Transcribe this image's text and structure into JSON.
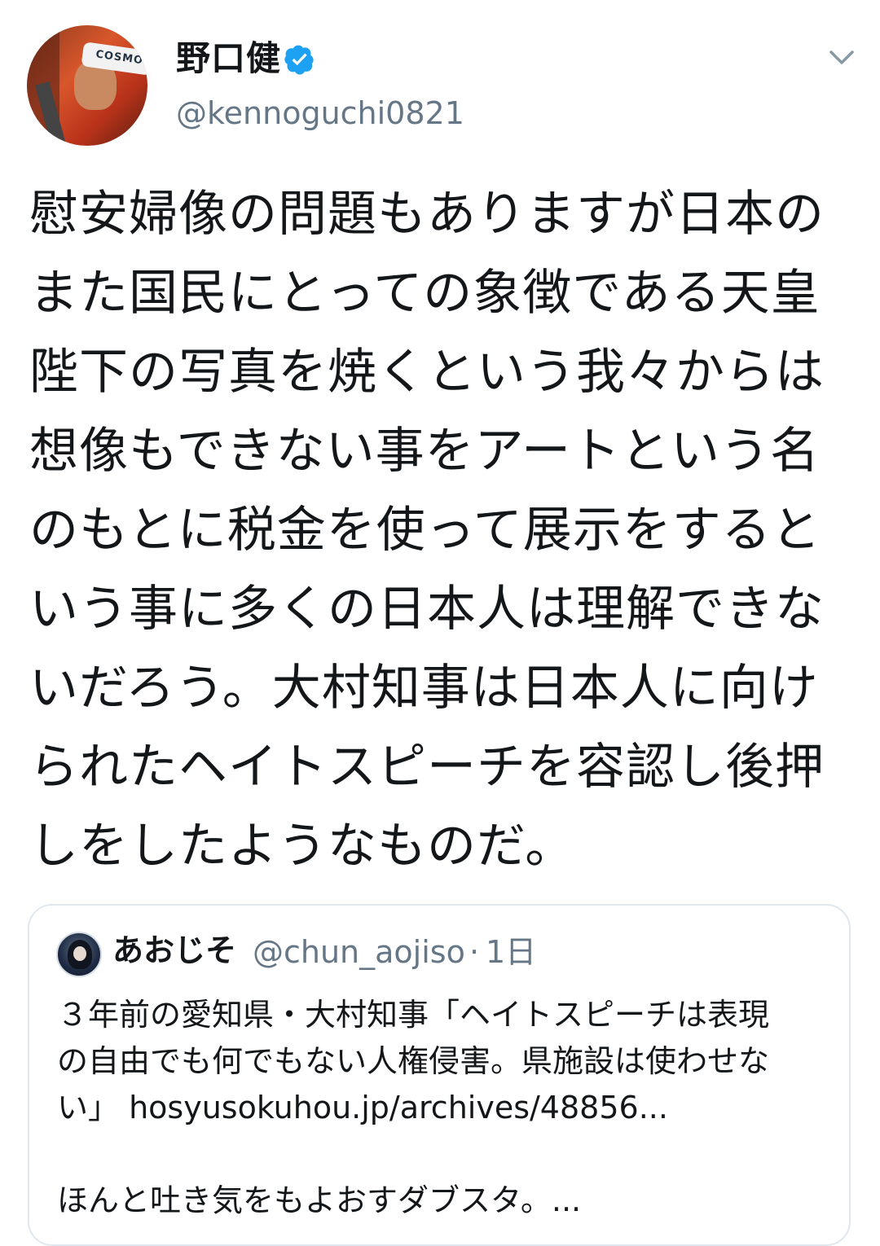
{
  "author": {
    "name": "野口健",
    "handle": "@kennoguchi0821",
    "avatar_badge_text": "COSMO",
    "verified": true,
    "verified_color": "#1da1f2"
  },
  "tweet": {
    "lines": [
      "慰安婦像の問題もありますが日本の",
      "また国民にとっての象徴である天皇",
      "陛下の写真を焼くという我々からは",
      "想像もできない事をアートという名",
      "のもとに税金を使って展示をすると",
      "いう事に多くの日本人は理解できな",
      "いだろう。大村知事は日本人に向け",
      "られたヘイトスピーチを容認し後押",
      "しをしたようなものだ。"
    ]
  },
  "quoted_tweet": {
    "name": "あおじそ",
    "handle": "@chun_aojiso",
    "separator": "·",
    "time": "1日",
    "lines": [
      "３年前の愛知県・大村知事「ヘイトスピーチは表現",
      "の自由でも何でもない人権侵害。県施設は使わせな",
      "い」 hosyusokuhou.jp/archives/48856...",
      "",
      "ほんと吐き気をもよおすダブスタ。..."
    ]
  },
  "icons": {
    "more": "chevron-down-icon",
    "verified": "verified-badge-icon"
  },
  "colors": {
    "text": "#14171a",
    "secondary": "#657786",
    "border": "#e1e8ed"
  }
}
